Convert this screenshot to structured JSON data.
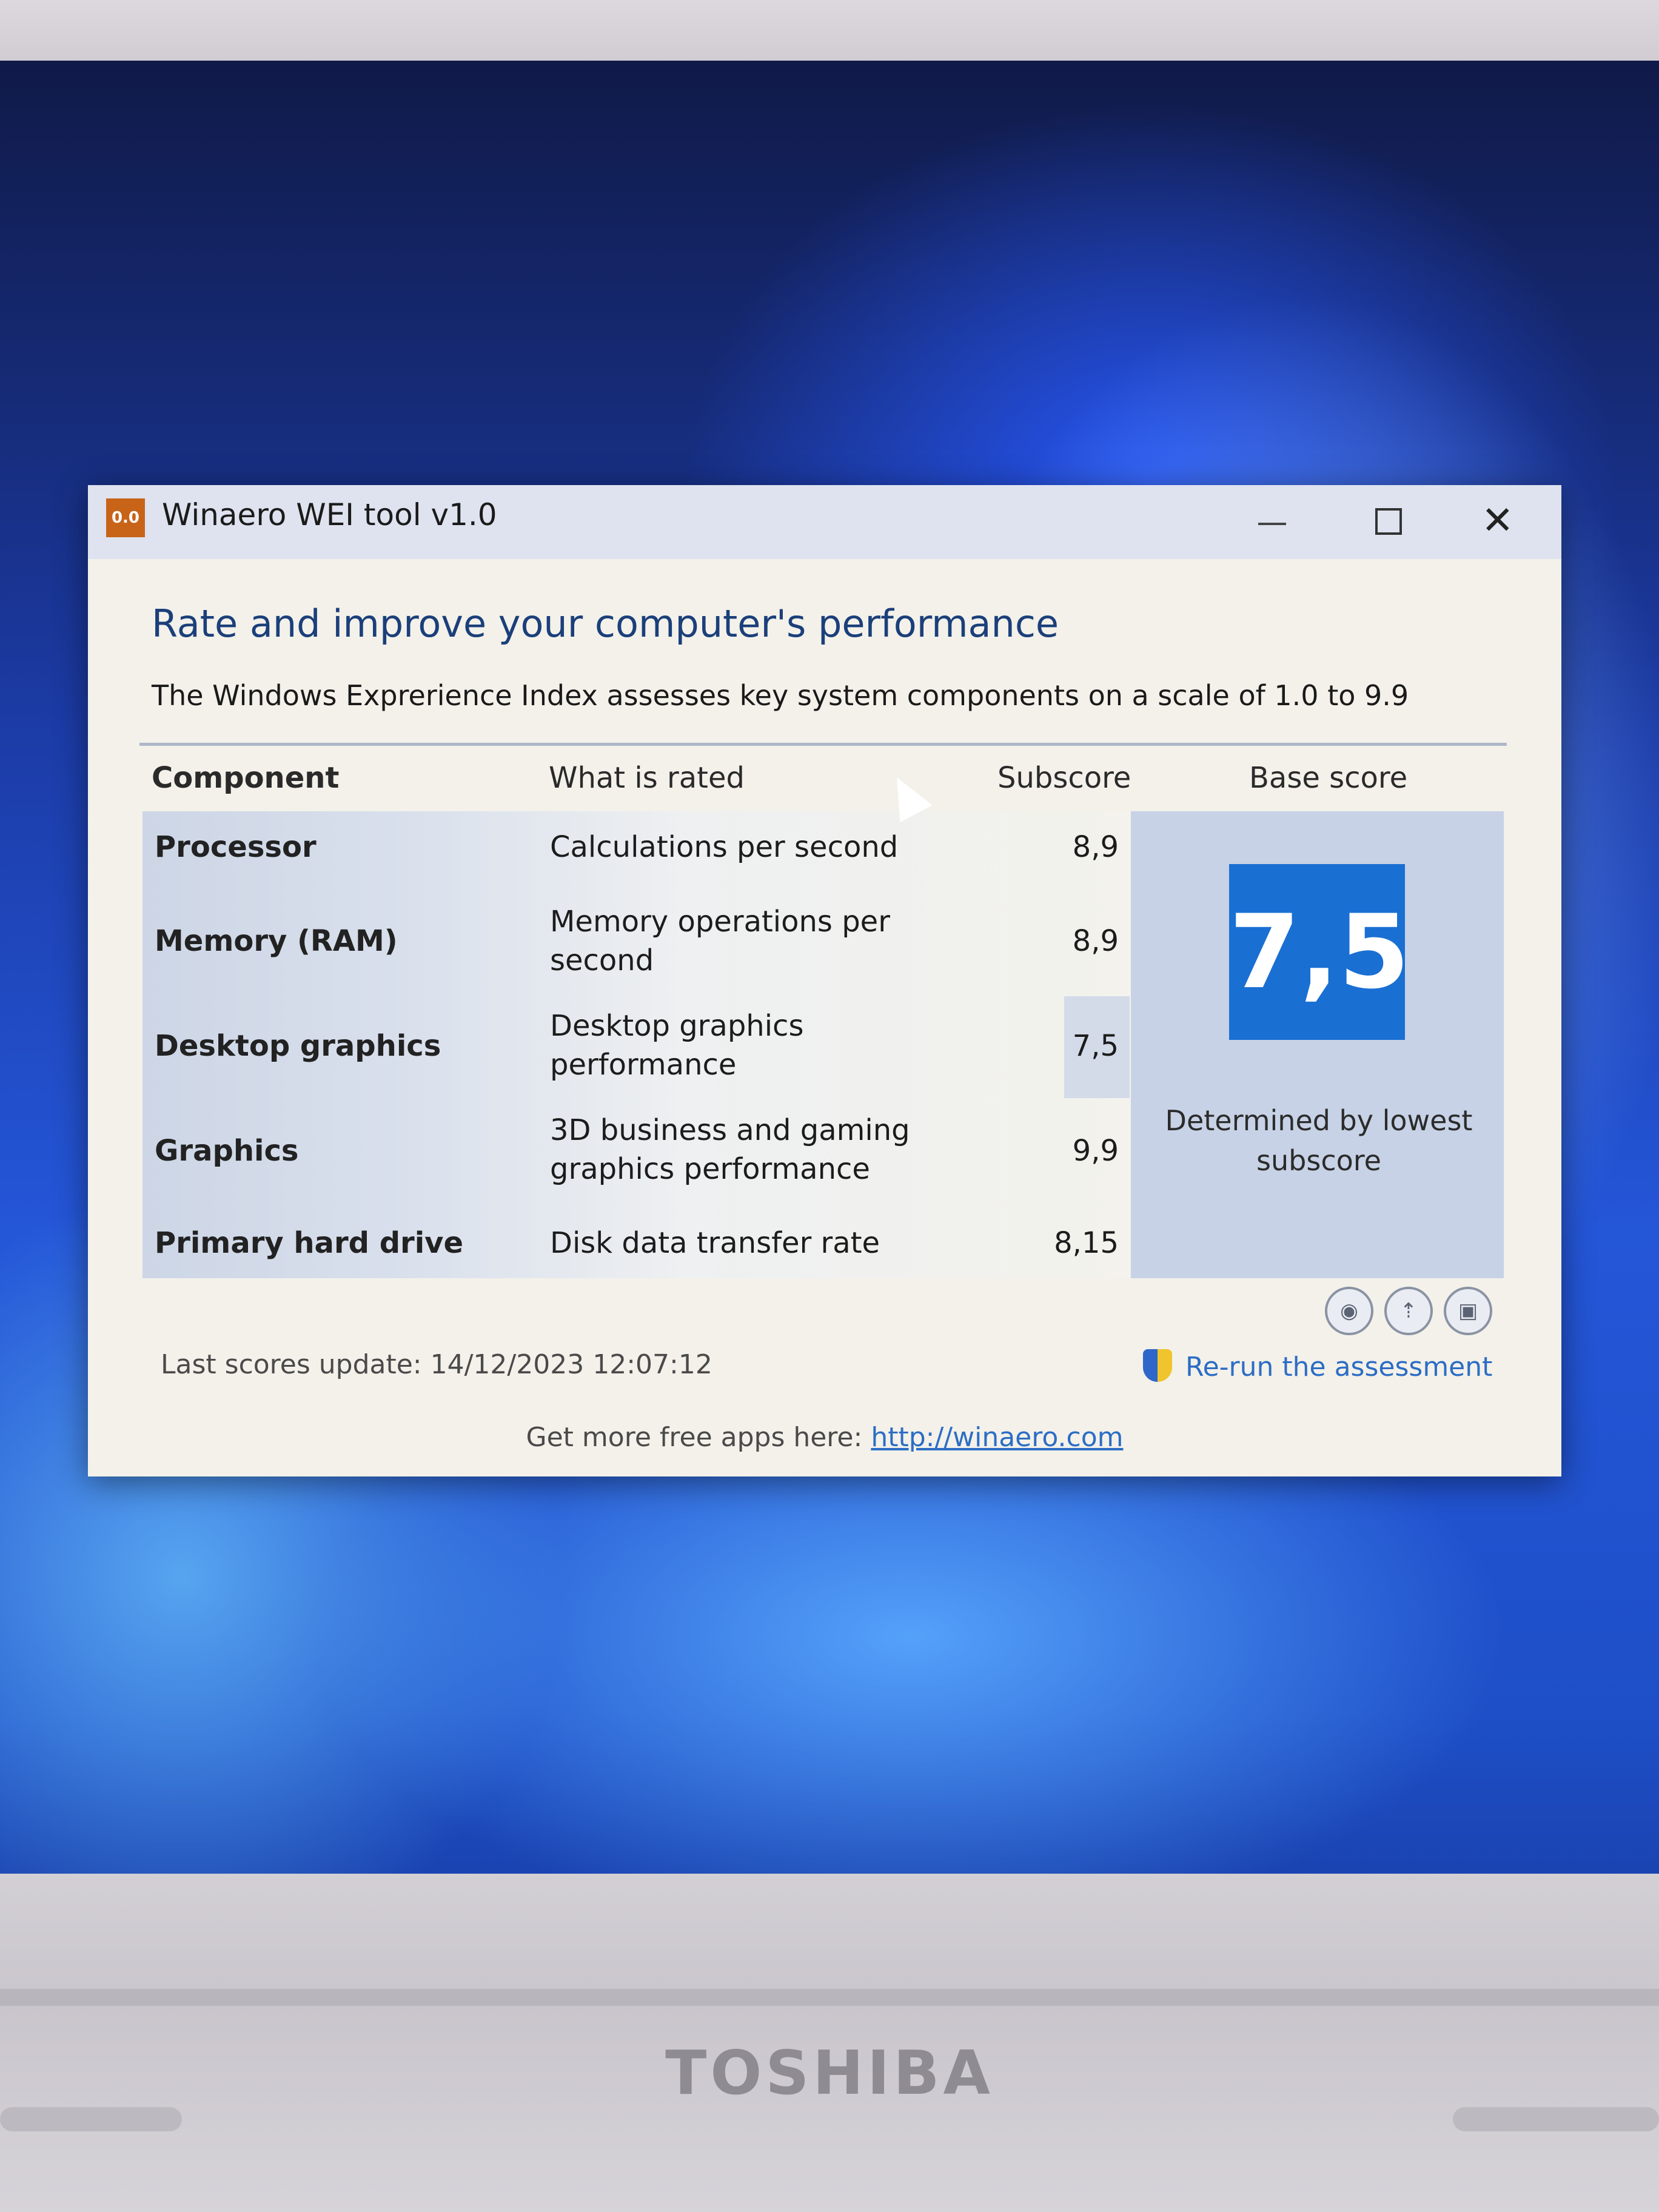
{
  "window": {
    "app_icon_text": "0.0",
    "title": "Winaero WEI tool v1.0"
  },
  "heading": "Rate and improve your computer's performance",
  "subtitle": "The Windows Exprerience Index assesses key system components on a scale of 1.0 to 9.9",
  "columns": {
    "component": "Component",
    "what": "What is rated",
    "subscore": "Subscore",
    "base": "Base score"
  },
  "rows": [
    {
      "component": "Processor",
      "what": "Calculations per second",
      "subscore": "8,9"
    },
    {
      "component": "Memory (RAM)",
      "what": "Memory operations per second",
      "subscore": "8,9"
    },
    {
      "component": "Desktop graphics",
      "what": "Desktop graphics performance",
      "subscore": "7,5"
    },
    {
      "component": "Graphics",
      "what": "3D business and gaming graphics performance",
      "subscore": "9,9"
    },
    {
      "component": "Primary hard drive",
      "what": "Disk data transfer rate",
      "subscore": "8,15"
    }
  ],
  "base_score": {
    "value": "7,5",
    "note": "Determined by lowest subscore",
    "color": "#1a6fd3"
  },
  "toolbar": {
    "icons": [
      "camera-icon",
      "upload-icon",
      "save-icon"
    ]
  },
  "status": {
    "last_update": "Last scores update: 14/12/2023 12:07:12",
    "rerun": "Re-run the assessment"
  },
  "footer": {
    "prefix": "Get more free apps here:",
    "link": "http://winaero.com"
  },
  "laptop": {
    "brand": "TOSHIBA"
  }
}
